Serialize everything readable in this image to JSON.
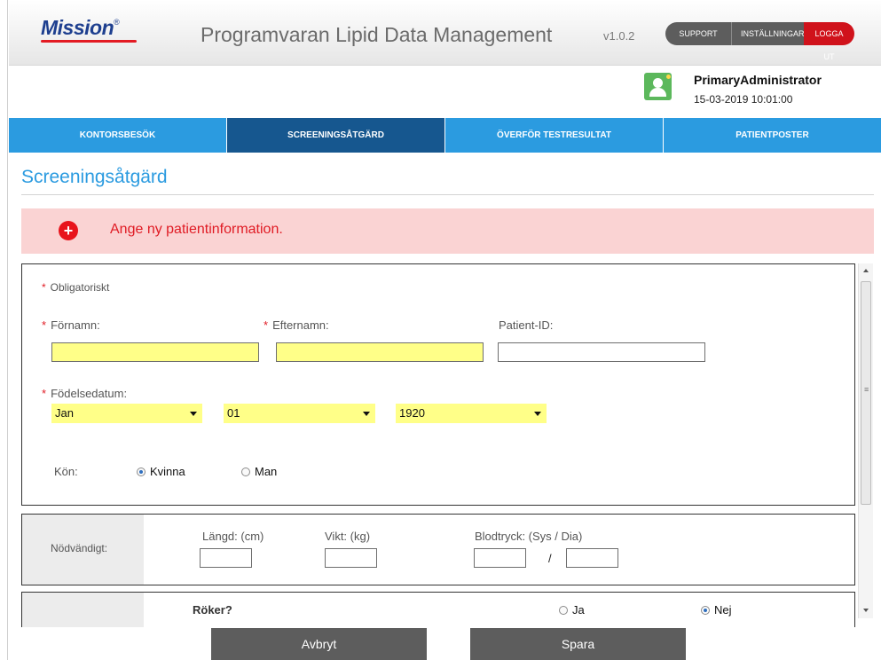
{
  "header": {
    "logo": "Mission",
    "logo_mark": "®",
    "app_title": "Programvaran Lipid Data Management",
    "version": "v1.0.2",
    "nav": {
      "support": "SUPPORT",
      "settings": "INSTÄLLNINGAR",
      "logout": "LOGGA UT"
    },
    "colors": {
      "logout": "#d0121b",
      "nav": "#5d5d5d",
      "logo": "#1e3f8f"
    }
  },
  "user": {
    "name": "PrimaryAdministrator",
    "datetime": "15-03-2019 10:01:00",
    "avatar_icon": "user-icon"
  },
  "tabs": [
    {
      "label": "KONTORSBESÖK",
      "active": false
    },
    {
      "label": "SCREENINGSÅTGÄRD",
      "active": true
    },
    {
      "label": "ÖVERFÖR TESTRESULTAT",
      "active": false
    },
    {
      "label": "PATIENTPOSTER",
      "active": false
    }
  ],
  "page": {
    "title": "Screeningsåtgärd"
  },
  "alert": {
    "text": "Ange ny patientinformation.",
    "icon": "plus-circle-icon",
    "color": "#e01b24"
  },
  "form": {
    "required_mark": "*",
    "required_note": "Obligatoriskt",
    "first_name": {
      "label": "Förnamn:",
      "value": ""
    },
    "last_name": {
      "label": "Efternamn:",
      "value": ""
    },
    "patient_id": {
      "label": "Patient-ID:",
      "value": ""
    },
    "dob": {
      "label": "Födelsedatum:",
      "month": "Jan",
      "day": "01",
      "year": "1920"
    },
    "gender": {
      "label": "Kön:",
      "female": "Kvinna",
      "male": "Man",
      "selected": "Kvinna"
    }
  },
  "required_section": {
    "label": "Nödvändigt:",
    "height": {
      "label": "Längd: (cm)",
      "value": ""
    },
    "weight": {
      "label": "Vikt: (kg)",
      "value": ""
    },
    "blood_pressure": {
      "label": "Blodtryck: (Sys / Dia)",
      "separator": "/",
      "sys": "",
      "dia": ""
    }
  },
  "smoker": {
    "label": "Röker?",
    "yes": "Ja",
    "no": "Nej",
    "selected": "Nej"
  },
  "footer": {
    "cancel": "Avbryt",
    "save": "Spara"
  }
}
